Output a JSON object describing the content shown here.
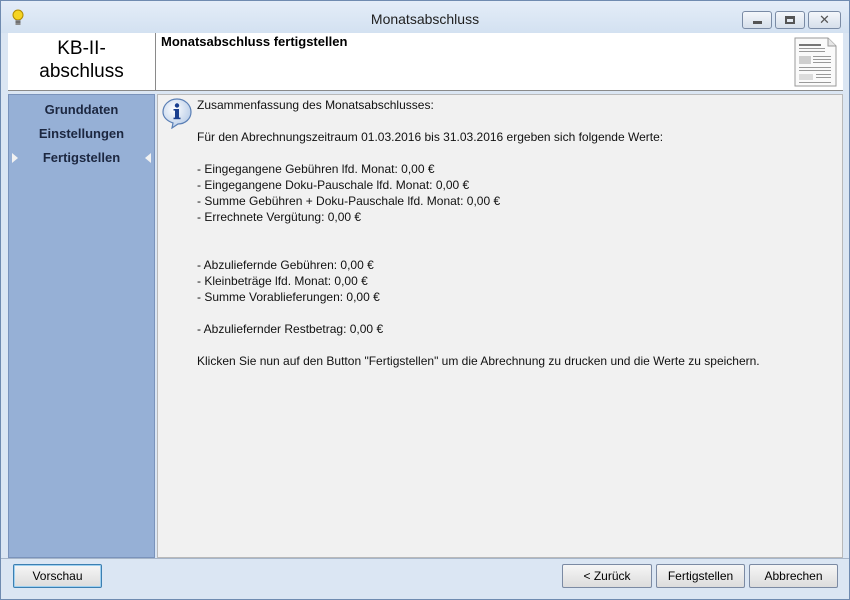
{
  "window": {
    "title": "Monatsabschluss"
  },
  "header": {
    "brand_line1": "KB-II-",
    "brand_line2": "abschluss",
    "title": "Monatsabschluss fertigstellen"
  },
  "sidebar": {
    "items": [
      {
        "label": "Grunddaten",
        "active": false
      },
      {
        "label": "Einstellungen",
        "active": false
      },
      {
        "label": "Fertigstellen",
        "active": true
      }
    ]
  },
  "content": {
    "heading": "Zusammenfassung des Monatsabschlusses:",
    "intro": "Für den Abrechnungszeitraum 01.03.2016 bis 31.03.2016 ergeben sich folgende Werte:",
    "values": [
      "- Eingegangene Gebühren lfd. Monat: 0,00 €",
      "- Eingegangene Doku-Pauschale lfd. Monat: 0,00 €",
      "- Summe Gebühren + Doku-Pauschale lfd. Monat: 0,00 €",
      "- Errechnete Vergütung: 0,00 €",
      "- Abzuliefernde Gebühren: 0,00 €",
      "- Kleinbeträge lfd. Monat: 0,00 €",
      "- Summe Vorablieferungen: 0,00 €",
      "- Abzuliefernder Restbetrag: 0,00 €"
    ],
    "instruction": "Klicken Sie nun auf den Button \"Fertigstellen\" um die Abrechnung zu drucken und die Werte zu speichern."
  },
  "footer": {
    "preview_label": "Vorschau",
    "back_label": "< Zurück",
    "finish_label": "Fertigstellen",
    "cancel_label": "Abbrechen"
  },
  "colors": {
    "sidebar_bg": "#96b0d6",
    "content_bg": "#f1f1f1",
    "window_frame": "#dbe6f3"
  }
}
